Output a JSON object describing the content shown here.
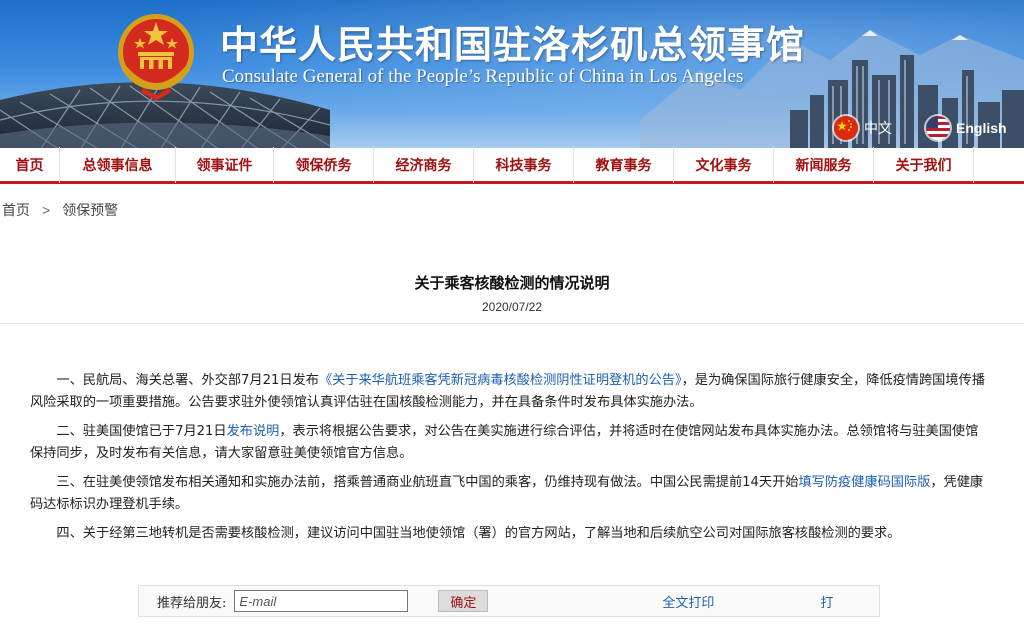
{
  "header": {
    "title_cn": "中华人民共和国驻洛杉矶总领事馆",
    "title_en": "Consulate General of the People’s Republic of China in Los Angeles",
    "lang_cn": "中文",
    "lang_en": "English"
  },
  "nav": {
    "items": [
      "首页",
      "总领事信息",
      "领事证件",
      "领保侨务",
      "经济商务",
      "科技事务",
      "教育事务",
      "文化事务",
      "新闻服务",
      "关于我们"
    ]
  },
  "breadcrumb": {
    "home": "首页",
    "separator": ">",
    "current": "领保预警"
  },
  "article": {
    "title": "关于乘客核酸检测的情况说明",
    "date": "2020/07/22",
    "p1_prefix": "一、民航局、海关总署、外交部7月21日发布",
    "p1_link": "《关于来华航班乘客凭新冠病毒核酸检测阴性证明登机的公告》",
    "p1_suffix": "，是为确保国际旅行健康安全，降低疫情跨国境传播风险采取的一项重要措施。公告要求驻外使领馆认真评估驻在国核酸检测能力，并在具备条件时发布具体实施办法。",
    "p2_prefix": "二、驻美国使馆已于7月21日",
    "p2_link": "发布说明",
    "p2_suffix": "，表示将根据公告要求，对公告在美实施进行综合评估，并将适时在使馆网站发布具体实施办法。总领馆将与驻美国使馆保持同步，及时发布有关信息，请大家留意驻美使领馆官方信息。",
    "p3_prefix": "三、在驻美使领馆发布相关通知和实施办法前，搭乘普通商业航班直飞中国的乘客，仍维持现有做法。中国公民需提前14天开始",
    "p3_link": "填写防疫健康码国际版",
    "p3_suffix": "，凭健康码达标标识办理登机手续。",
    "p4": "四、关于经第三地转机是否需要核酸检测，建议访问中国驻当地使领馆（署）的官方网站，了解当地和后续航空公司对国际旅客核酸检测的要求。"
  },
  "toolbar": {
    "recommend_label": "推荐给朋友:",
    "email_placeholder": "E-mail",
    "confirm_label": "确定",
    "print_label": "全文打印",
    "partial_label": "打"
  },
  "colors": {
    "nav_text": "#a01010",
    "nav_underline": "#c9151e",
    "link": "#1c5fb5",
    "banner_top": "#1d6fc9"
  }
}
